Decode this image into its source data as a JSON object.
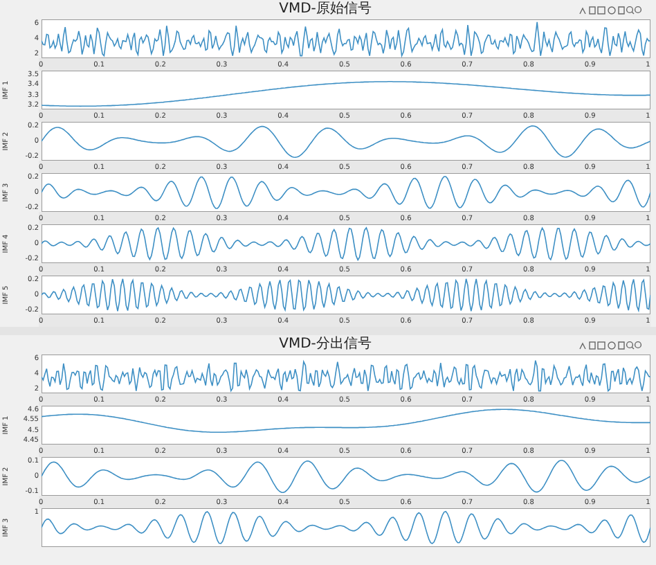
{
  "figures": [
    {
      "title": "VMD-原始信号",
      "plots": [
        {
          "kind": "signal",
          "yticks": [
            "6",
            "4",
            "2"
          ],
          "xticks": [
            "0",
            "0.1",
            "0.2",
            "0.3",
            "0.4",
            "0.5",
            "0.6",
            "0.7",
            "0.8",
            "0.9",
            "1"
          ]
        },
        {
          "kind": "trend",
          "ylabel": "IMF 1",
          "yticks": [
            "3.5",
            "3.4",
            "3.3",
            "3.2"
          ],
          "xticks": [
            "0",
            "0.1",
            "0.2",
            "0.3",
            "0.4",
            "0.5",
            "0.6",
            "0.7",
            "0.8",
            "0.9",
            "1"
          ]
        },
        {
          "kind": "mode",
          "ylabel": "IMF 2",
          "yticks": [
            "0.2",
            "0",
            "-0.2"
          ],
          "xticks": [
            "0",
            "0.1",
            "0.2",
            "0.3",
            "0.4",
            "0.5",
            "0.6",
            "0.7",
            "0.8",
            "0.9",
            "1"
          ]
        },
        {
          "kind": "mode",
          "ylabel": "IMF 3",
          "yticks": [
            "0.2",
            "0",
            "-0.2"
          ],
          "xticks": [
            "0",
            "0.1",
            "0.2",
            "0.3",
            "0.4",
            "0.5",
            "0.6",
            "0.7",
            "0.8",
            "0.9",
            "1"
          ]
        },
        {
          "kind": "mode",
          "ylabel": "IMF 4",
          "yticks": [
            "0.2",
            "0",
            "-0.2"
          ],
          "xticks": [
            "0",
            "0.1",
            "0.2",
            "0.3",
            "0.4",
            "0.5",
            "0.6",
            "0.7",
            "0.8",
            "0.9",
            "1"
          ]
        },
        {
          "kind": "mode",
          "ylabel": "IMF 5",
          "yticks": [
            "0.2",
            "0",
            "-0.2"
          ],
          "xticks": [
            "0",
            "0.1",
            "0.2",
            "0.3",
            "0.4",
            "0.5",
            "0.6",
            "0.7",
            "0.8",
            "0.9",
            "1"
          ]
        }
      ]
    },
    {
      "title": "VMD-分出信号",
      "plots": [
        {
          "kind": "signal",
          "yticks": [
            "6",
            "4",
            "2"
          ],
          "xticks": [
            "0",
            "0.1",
            "0.2",
            "0.3",
            "0.4",
            "0.5",
            "0.6",
            "0.7",
            "0.8",
            "0.9",
            "1"
          ]
        },
        {
          "kind": "trend",
          "ylabel": "IMF 1",
          "yticks": [
            "4.6",
            "4.55",
            "4.5",
            "4.45"
          ],
          "xticks": [
            "0",
            "0.1",
            "0.2",
            "0.3",
            "0.4",
            "0.5",
            "0.6",
            "0.7",
            "0.8",
            "0.9",
            "1"
          ]
        },
        {
          "kind": "mode",
          "ylabel": "IMF 2",
          "yticks": [
            "0.1",
            "0",
            "-0.1"
          ],
          "xticks": [
            "0",
            "0.1",
            "0.2",
            "0.3",
            "0.4",
            "0.5",
            "0.6",
            "0.7",
            "0.8",
            "0.9",
            "1"
          ]
        },
        {
          "kind": "mode",
          "ylabel": "IMF 3",
          "yticks": [
            "1"
          ]
        }
      ]
    }
  ]
}
